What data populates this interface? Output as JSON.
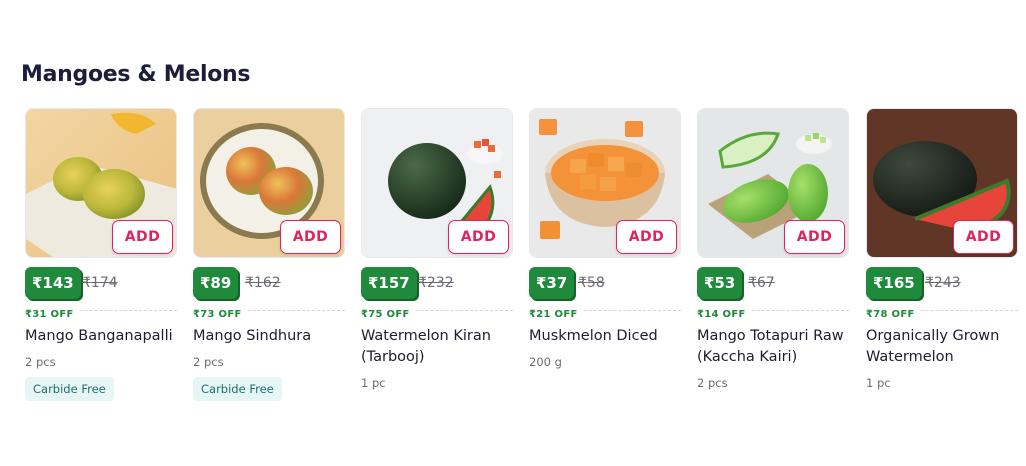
{
  "section": {
    "title": "Mangoes & Melons"
  },
  "add_label": "ADD",
  "colors": {
    "accent": "#e0245e",
    "price_badge": "#1f8a3b",
    "tag_bg": "#e6f6f6"
  },
  "products": [
    {
      "name": "Mango Banganapalli",
      "price": "₹143",
      "mrp": "₹174",
      "off": "₹31 OFF",
      "qty": "2 pcs",
      "tag": "Carbide Free"
    },
    {
      "name": "Mango Sindhura",
      "price": "₹89",
      "mrp": "₹162",
      "off": "₹73 OFF",
      "qty": "2 pcs",
      "tag": "Carbide Free"
    },
    {
      "name": "Watermelon Kiran (Tarbooj)",
      "price": "₹157",
      "mrp": "₹232",
      "off": "₹75 OFF",
      "qty": "1 pc"
    },
    {
      "name": "Muskmelon Diced",
      "price": "₹37",
      "mrp": "₹58",
      "off": "₹21 OFF",
      "qty": "200 g"
    },
    {
      "name": "Mango Totapuri Raw (Kaccha Kairi)",
      "price": "₹53",
      "mrp": "₹67",
      "off": "₹14 OFF",
      "qty": "2 pcs"
    },
    {
      "name": "Organically Grown Watermelon",
      "price": "₹165",
      "mrp": "₹243",
      "off": "₹78 OFF",
      "qty": "1 pc"
    }
  ]
}
